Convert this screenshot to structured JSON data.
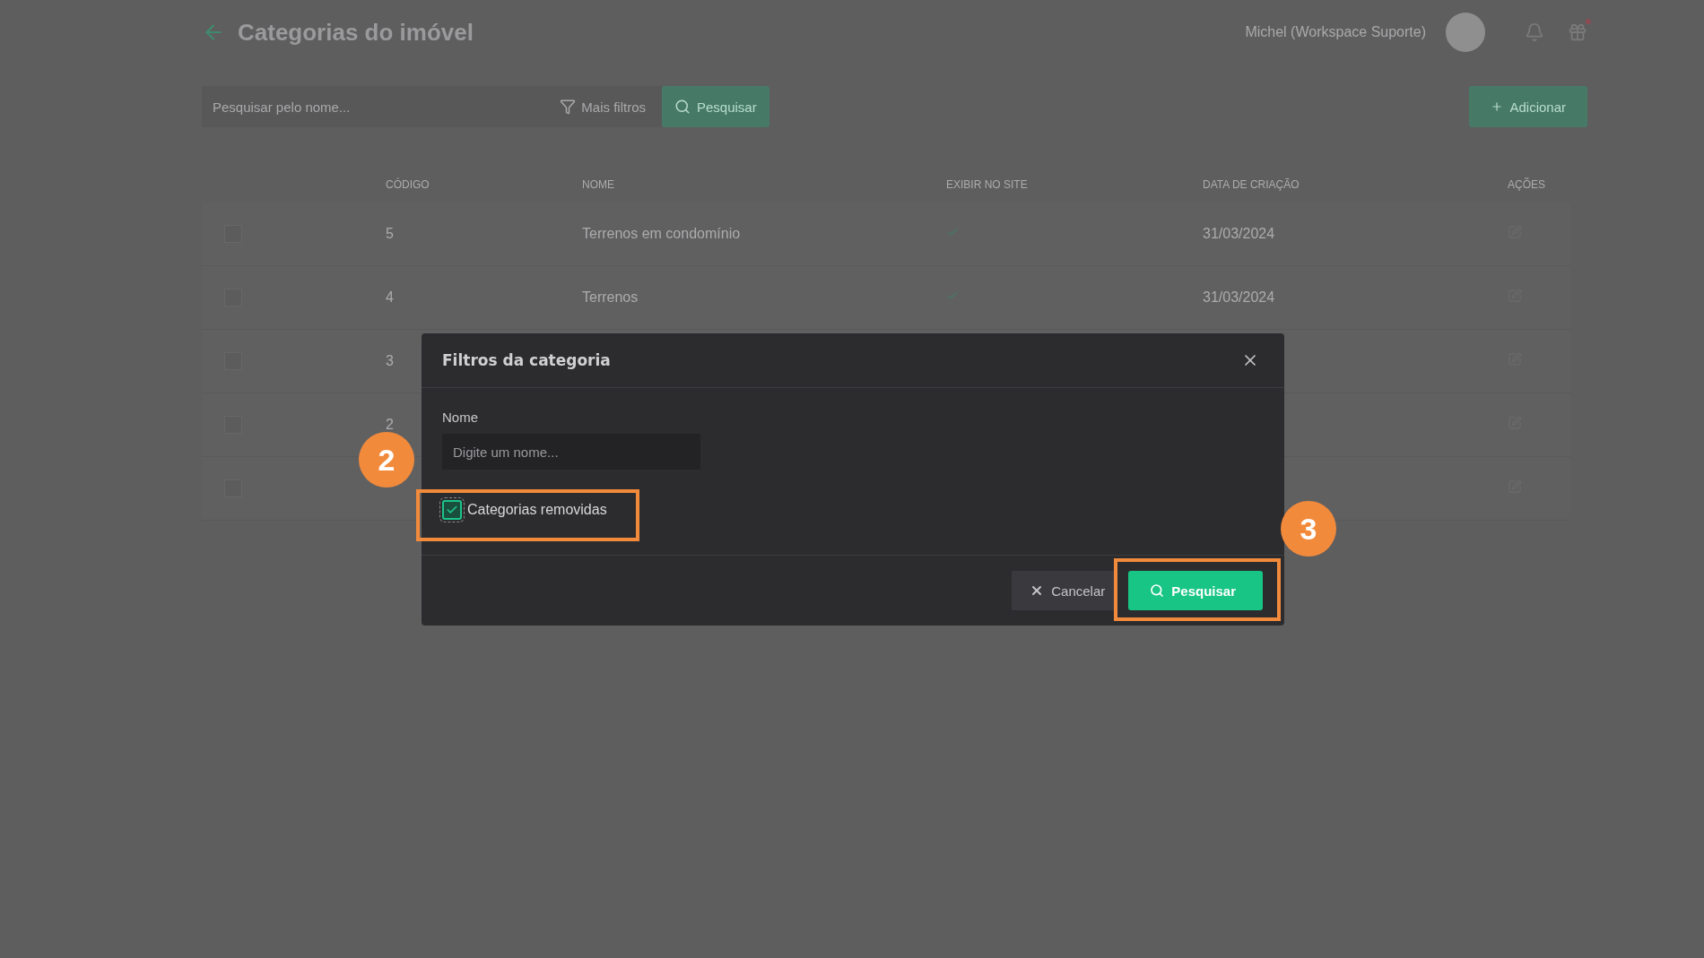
{
  "header": {
    "title": "Categorias do imóvel",
    "user": "Michel (Workspace Suporte)",
    "gift_has_notification": true
  },
  "toolbar": {
    "search_placeholder": "Pesquisar pelo nome...",
    "filters_button": "Mais filtros",
    "search_button": "Pesquisar",
    "add_button": "Adicionar"
  },
  "table": {
    "columns": [
      "CÓDIGO",
      "NOME",
      "EXIBIR NO SITE",
      "DATA DE CRIAÇÃO",
      "AÇÕES"
    ],
    "rows": [
      {
        "checked": false,
        "code": "5",
        "name": "Terrenos em condomínio",
        "show_on_site": true,
        "date": "31/03/2024"
      },
      {
        "checked": false,
        "code": "4",
        "name": "Terrenos",
        "show_on_site": true,
        "date": "31/03/2024"
      },
      {
        "checked": false,
        "code": "3"
      },
      {
        "checked": false,
        "code": "2"
      },
      {
        "checked": false
      }
    ]
  },
  "modal": {
    "title": "Filtros da categoria",
    "name_label": "Nome",
    "name_placeholder": "Digite um nome...",
    "removed_label": "Categorias removidas",
    "removed_checked": true,
    "cancel_button": "Cancelar",
    "search_button": "Pesquisar"
  },
  "annotations": [
    {
      "number": "2"
    },
    {
      "number": "3"
    }
  ]
}
